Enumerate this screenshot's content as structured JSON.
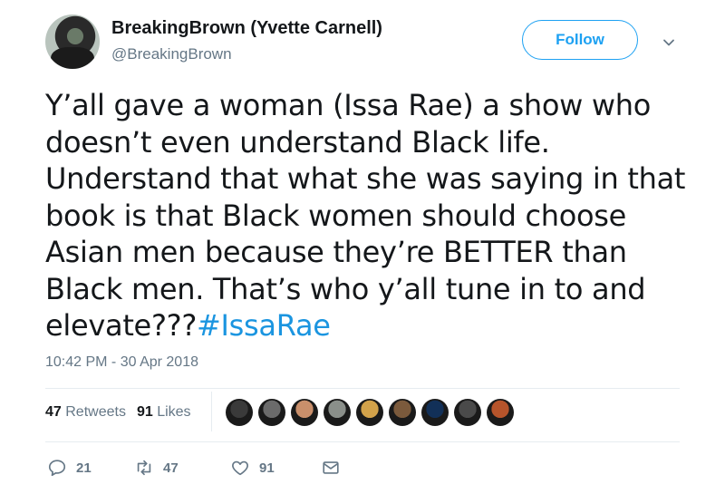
{
  "user": {
    "display_name": "BreakingBrown (Yvette Carnell)",
    "handle": "@BreakingBrown"
  },
  "follow_label": "Follow",
  "tweet": {
    "text": "Y’all gave a woman (Issa Rae) a show who doesn’t even understand Black life. Understand that what she was saying in that book is that Black women should choose Asian men because they’re BETTER than Black men. That’s who y’all tune in to and elevate???",
    "hashtag": "#IssaRae"
  },
  "timestamp": "10:42 PM - 30 Apr 2018",
  "stats": {
    "retweets_count": "47",
    "retweets_label": "Retweets",
    "likes_count": "91",
    "likes_label": "Likes"
  },
  "liker_avatars": [
    "#3a3a3a",
    "#6b6b6b",
    "#c98f6b",
    "#8a8f8a",
    "#d2a24a",
    "#7b5a3c",
    "#123058",
    "#4a4a4a",
    "#b6542b"
  ],
  "actions": {
    "reply_count": "21",
    "retweet_count": "47",
    "like_count": "91"
  },
  "colors": {
    "accent": "#1da1f2",
    "hashtag": "#1b95e0",
    "muted": "#657786",
    "divider": "#e6ecf0"
  },
  "icons": [
    "chevron-down-icon",
    "reply-icon",
    "retweet-icon",
    "heart-icon",
    "envelope-icon"
  ]
}
